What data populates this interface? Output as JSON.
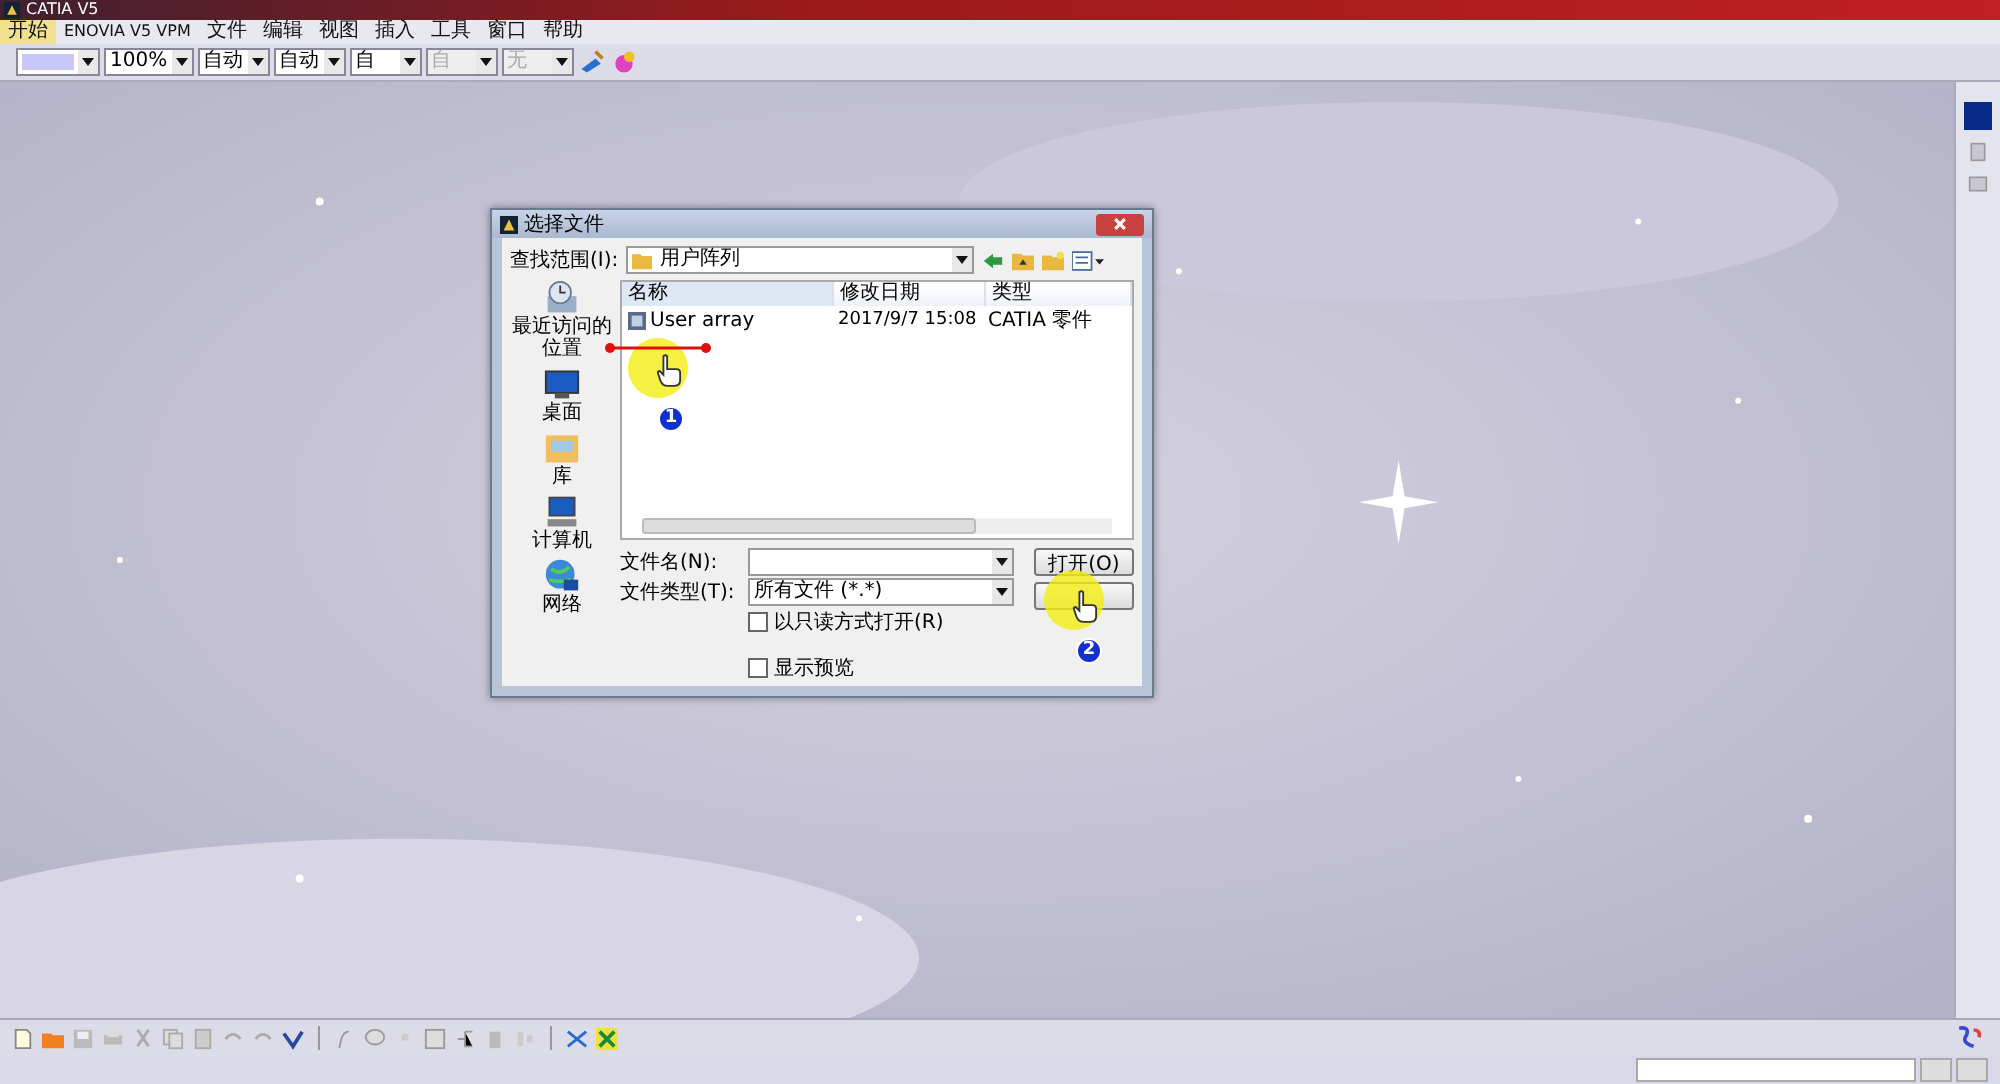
{
  "window": {
    "title": "CATIA V5"
  },
  "menu": [
    {
      "label": "开始",
      "selected": true
    },
    {
      "label": "ENOVIA V5 VPM",
      "selected": false
    },
    {
      "label": "文件",
      "selected": false
    },
    {
      "label": "编辑",
      "selected": false
    },
    {
      "label": "视图",
      "selected": false
    },
    {
      "label": "插入",
      "selected": false
    },
    {
      "label": "工具",
      "selected": false
    },
    {
      "label": "窗口",
      "selected": false
    },
    {
      "label": "帮助",
      "selected": false
    }
  ],
  "format_toolbar": [
    {
      "kind": "color",
      "disabled": false
    },
    {
      "kind": "combo",
      "value": "100%",
      "disabled": false
    },
    {
      "kind": "combo",
      "value": "自动",
      "disabled": false
    },
    {
      "kind": "combo",
      "value": "自动",
      "disabled": false
    },
    {
      "kind": "combo",
      "value": "自",
      "disabled": false
    },
    {
      "kind": "combo",
      "value": "自",
      "disabled": true
    },
    {
      "kind": "combo",
      "value": "无",
      "disabled": true
    }
  ],
  "dialog": {
    "title": "选择文件",
    "look_in_label": "查找范围(I):",
    "look_in": "用户阵列",
    "places": [
      {
        "kind": "recent",
        "label": "最近访问的位置"
      },
      {
        "kind": "desktop",
        "label": "桌面"
      },
      {
        "kind": "library",
        "label": "库"
      },
      {
        "kind": "computer",
        "label": "计算机"
      },
      {
        "kind": "network",
        "label": "网络"
      }
    ],
    "columns": [
      "名称",
      "修改日期",
      "类型"
    ],
    "files": [
      {
        "name": "User array",
        "modified": "2017/9/7 15:08",
        "type": "CATIA 零件"
      }
    ],
    "file_name_label": "文件名(N):",
    "file_type_label": "文件类型(T):",
    "file_type": "所有文件 (*.*)",
    "read_only": {
      "label": "以只读方式打开(R)",
      "checked": false
    },
    "preview": {
      "label": "显示预览",
      "checked": false
    },
    "open_button": "打开(O)",
    "steps": [
      "1",
      "2"
    ]
  }
}
